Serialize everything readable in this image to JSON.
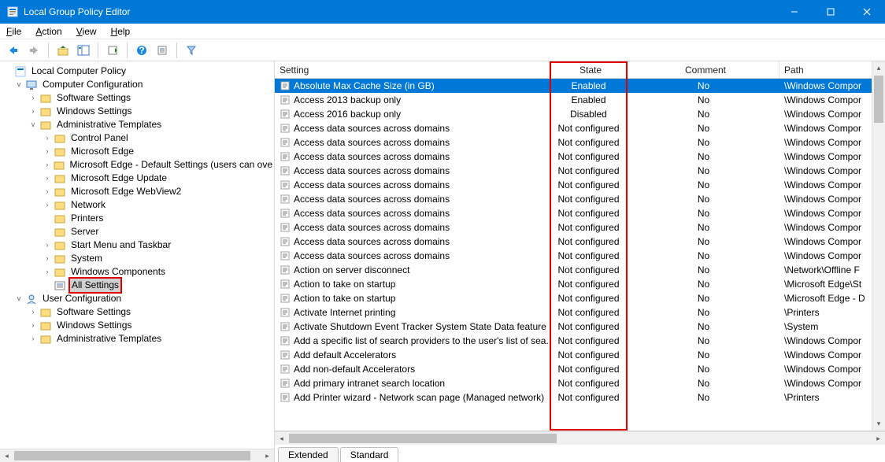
{
  "window": {
    "title": "Local Group Policy Editor"
  },
  "menu": {
    "file": "File",
    "action": "Action",
    "view": "View",
    "help": "Help"
  },
  "columns": {
    "setting": "Setting",
    "state": "State",
    "comment": "Comment",
    "path": "Path"
  },
  "tabs": {
    "extended": "Extended",
    "standard": "Standard"
  },
  "tree": {
    "root": "Local Computer Policy",
    "computer_config": "Computer Configuration",
    "software_settings": "Software Settings",
    "windows_settings": "Windows Settings",
    "admin_templates": "Administrative Templates",
    "user_config": "User Configuration",
    "at_children": {
      "control_panel": "Control Panel",
      "edge": "Microsoft Edge",
      "edge_defaults": "Microsoft Edge - Default Settings (users can ove",
      "edge_update": "Microsoft Edge Update",
      "edge_webview2": "Microsoft Edge WebView2",
      "network": "Network",
      "printers": "Printers",
      "server": "Server",
      "start_menu": "Start Menu and Taskbar",
      "system": "System",
      "windows_components": "Windows Components",
      "all_settings": "All Settings"
    }
  },
  "rows": [
    {
      "setting": "Absolute Max Cache Size (in GB)",
      "state": "Enabled",
      "comment": "No",
      "path": "\\Windows Compor",
      "selected": true
    },
    {
      "setting": "Access 2013 backup only",
      "state": "Enabled",
      "comment": "No",
      "path": "\\Windows Compor"
    },
    {
      "setting": "Access 2016 backup only",
      "state": "Disabled",
      "comment": "No",
      "path": "\\Windows Compor"
    },
    {
      "setting": "Access data sources across domains",
      "state": "Not configured",
      "comment": "No",
      "path": "\\Windows Compor"
    },
    {
      "setting": "Access data sources across domains",
      "state": "Not configured",
      "comment": "No",
      "path": "\\Windows Compor"
    },
    {
      "setting": "Access data sources across domains",
      "state": "Not configured",
      "comment": "No",
      "path": "\\Windows Compor"
    },
    {
      "setting": "Access data sources across domains",
      "state": "Not configured",
      "comment": "No",
      "path": "\\Windows Compor"
    },
    {
      "setting": "Access data sources across domains",
      "state": "Not configured",
      "comment": "No",
      "path": "\\Windows Compor"
    },
    {
      "setting": "Access data sources across domains",
      "state": "Not configured",
      "comment": "No",
      "path": "\\Windows Compor"
    },
    {
      "setting": "Access data sources across domains",
      "state": "Not configured",
      "comment": "No",
      "path": "\\Windows Compor"
    },
    {
      "setting": "Access data sources across domains",
      "state": "Not configured",
      "comment": "No",
      "path": "\\Windows Compor"
    },
    {
      "setting": "Access data sources across domains",
      "state": "Not configured",
      "comment": "No",
      "path": "\\Windows Compor"
    },
    {
      "setting": "Access data sources across domains",
      "state": "Not configured",
      "comment": "No",
      "path": "\\Windows Compor"
    },
    {
      "setting": "Action on server disconnect",
      "state": "Not configured",
      "comment": "No",
      "path": "\\Network\\Offline F"
    },
    {
      "setting": "Action to take on startup",
      "state": "Not configured",
      "comment": "No",
      "path": "\\Microsoft Edge\\St"
    },
    {
      "setting": "Action to take on startup",
      "state": "Not configured",
      "comment": "No",
      "path": "\\Microsoft Edge - D"
    },
    {
      "setting": "Activate Internet printing",
      "state": "Not configured",
      "comment": "No",
      "path": "\\Printers"
    },
    {
      "setting": "Activate Shutdown Event Tracker System State Data feature",
      "state": "Not configured",
      "comment": "No",
      "path": "\\System"
    },
    {
      "setting": "Add a specific list of search providers to the user's list of sea...",
      "state": "Not configured",
      "comment": "No",
      "path": "\\Windows Compor"
    },
    {
      "setting": "Add default Accelerators",
      "state": "Not configured",
      "comment": "No",
      "path": "\\Windows Compor"
    },
    {
      "setting": "Add non-default Accelerators",
      "state": "Not configured",
      "comment": "No",
      "path": "\\Windows Compor"
    },
    {
      "setting": "Add primary intranet search location",
      "state": "Not configured",
      "comment": "No",
      "path": "\\Windows Compor"
    },
    {
      "setting": "Add Printer wizard - Network scan page (Managed network)",
      "state": "Not configured",
      "comment": "No",
      "path": "\\Printers"
    }
  ]
}
